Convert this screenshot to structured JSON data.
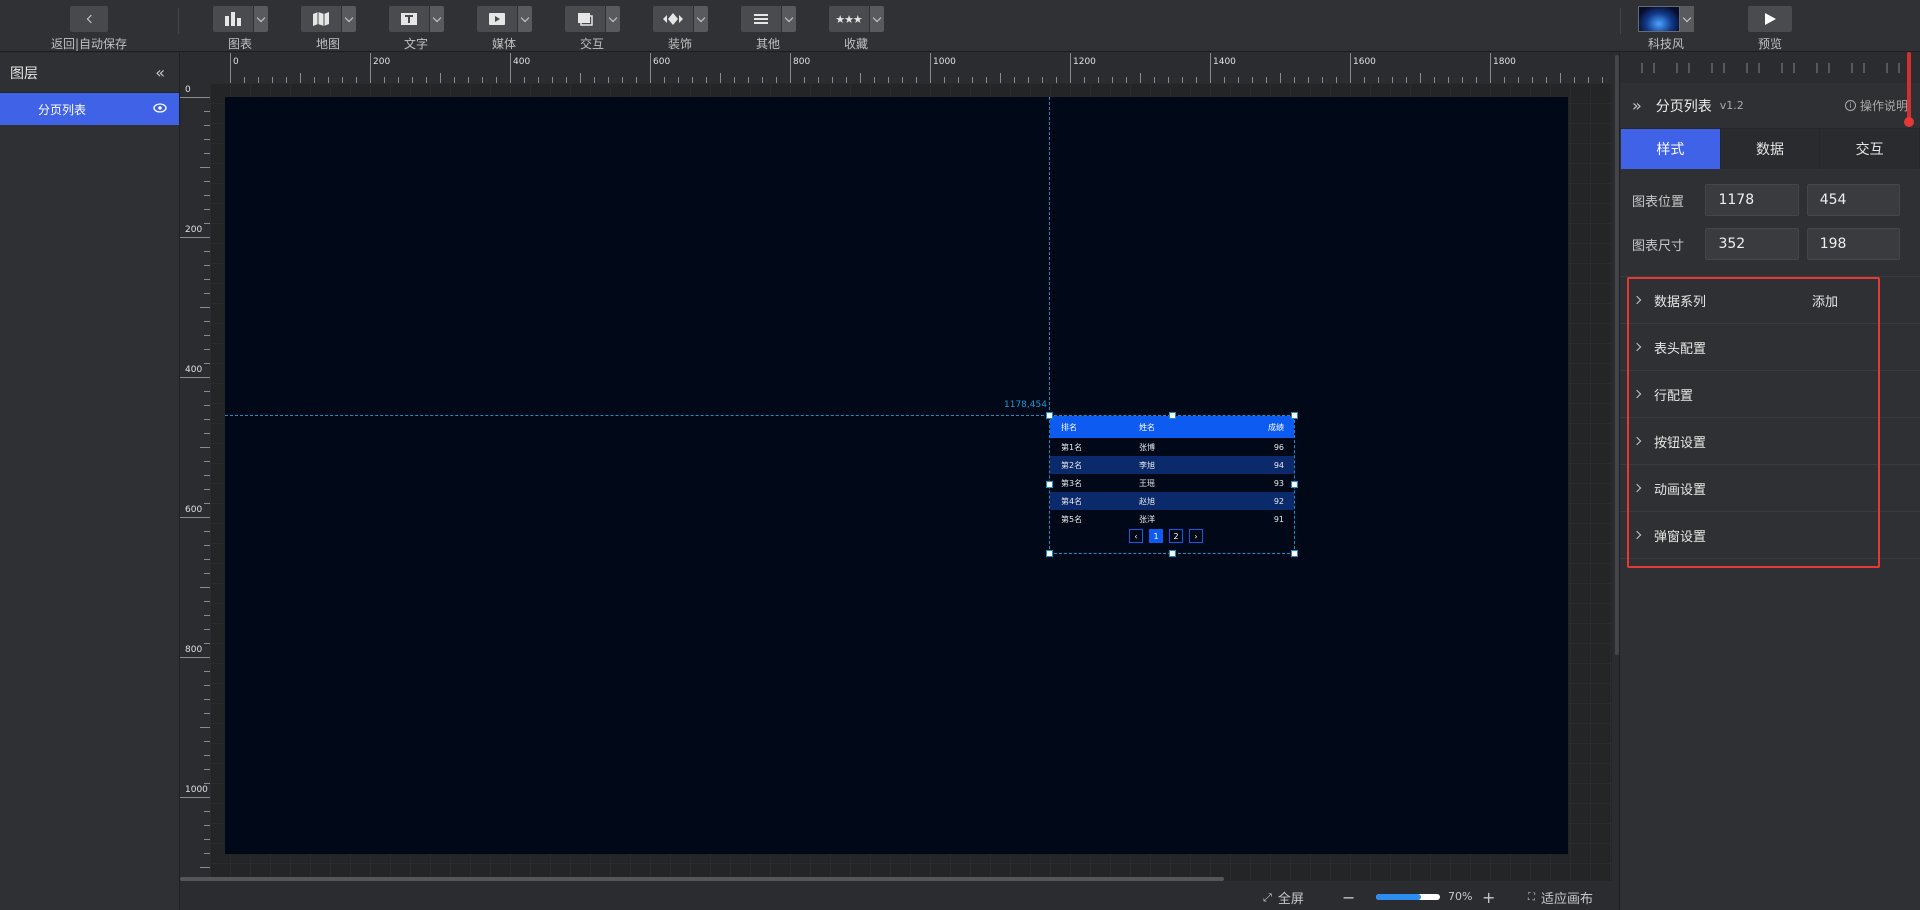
{
  "toolbar": {
    "back_label": "返回|自动保存",
    "items": [
      {
        "label": "图表",
        "icon": "chart-icon"
      },
      {
        "label": "地图",
        "icon": "map-icon"
      },
      {
        "label": "文字",
        "icon": "text-icon"
      },
      {
        "label": "媒体",
        "icon": "media-icon"
      },
      {
        "label": "交互",
        "icon": "interaction-icon"
      },
      {
        "label": "装饰",
        "icon": "decoration-icon"
      },
      {
        "label": "其他",
        "icon": "other-icon"
      },
      {
        "label": "收藏",
        "icon": "favorites-icon"
      }
    ],
    "theme_label": "科技风",
    "preview_label": "预览"
  },
  "layers": {
    "title": "图层",
    "items": [
      {
        "label": "分页列表"
      }
    ]
  },
  "ruler": {
    "h_labels": [
      "0",
      "200",
      "400",
      "600",
      "800",
      "1000",
      "1200",
      "1400",
      "1600",
      "1800"
    ],
    "v_labels": [
      "0",
      "200",
      "400",
      "600",
      "800",
      "1000"
    ]
  },
  "canvas": {
    "coord_label": "1178,454",
    "table": {
      "headers": [
        "排名",
        "姓名",
        "成绩"
      ],
      "rows": [
        [
          "第1名",
          "张博",
          "96"
        ],
        [
          "第2名",
          "李旭",
          "94"
        ],
        [
          "第3名",
          "王瑶",
          "93"
        ],
        [
          "第4名",
          "赵旭",
          "92"
        ],
        [
          "第5名",
          "张洋",
          "91"
        ]
      ],
      "pages": [
        "1",
        "2"
      ],
      "current_page": "1"
    }
  },
  "status": {
    "fullscreen_label": "全屏",
    "zoom": "70%",
    "fit_label": "适应画布"
  },
  "panel": {
    "component_name": "分页列表",
    "version": "v1.2",
    "help_label": "操作说明",
    "tabs": [
      "样式",
      "数据",
      "交互"
    ],
    "position_label": "图表位置",
    "position": {
      "x": "1178",
      "y": "454"
    },
    "size_label": "图表尺寸",
    "size": {
      "w": "352",
      "h": "198"
    },
    "sections": [
      "数据系列",
      "表头配置",
      "行配置",
      "按钮设置",
      "动画设置",
      "弹窗设置"
    ],
    "add_label": "添加"
  },
  "colors": {
    "accent": "#3f62e6",
    "table_header": "#0d5bf0",
    "screen_bg": "#010818",
    "highlight": "#e53935"
  }
}
